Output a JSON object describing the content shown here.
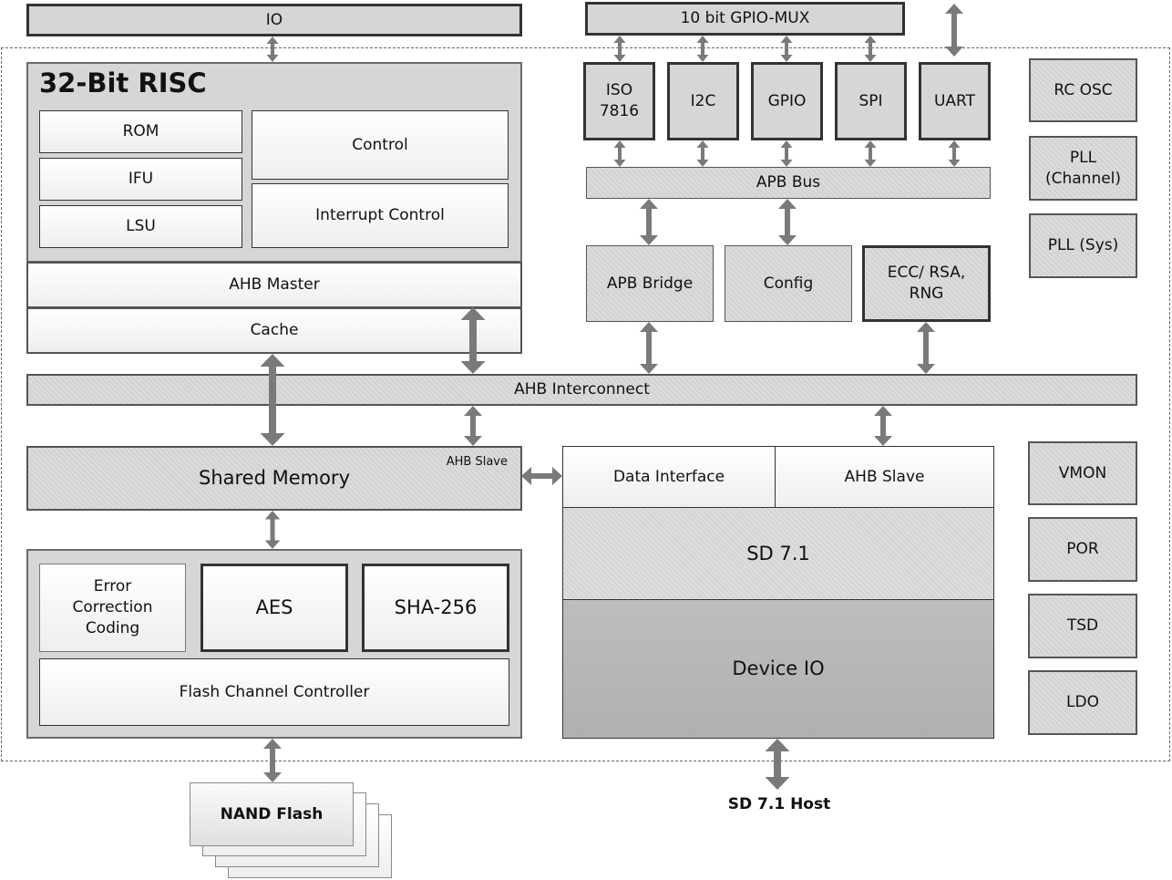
{
  "io": "IO",
  "gpio_mux": "10 bit GPIO-MUX",
  "risc": {
    "title": "32-Bit RISC",
    "rom": "ROM",
    "ifu": "IFU",
    "lsu": "LSU",
    "control": "Control",
    "interrupt": "Interrupt Control",
    "ahb_master": "AHB Master",
    "cache": "Cache"
  },
  "peripherals": [
    "ISO 7816",
    "I2C",
    "GPIO",
    "SPI",
    "UART"
  ],
  "apb_bus": "APB Bus",
  "apb_bridge": "APB Bridge",
  "config": "Config",
  "ecc_rsa": "ECC/ RSA, RNG",
  "clocks": [
    "RC OSC",
    "PLL (Channel)",
    "PLL (Sys)"
  ],
  "ahb_interconnect": "AHB Interconnect",
  "shared_memory": "Shared Memory",
  "shared_memory_slave": "AHB Slave",
  "sd": {
    "data_interface": "Data Interface",
    "ahb_slave": "AHB Slave",
    "sd71": "SD 7.1",
    "device_io": "Device IO",
    "host": "SD 7.1 Host"
  },
  "analog": [
    "VMON",
    "POR",
    "TSD",
    "LDO"
  ],
  "flash": {
    "ecc": "Error Correction Coding",
    "aes": "AES",
    "sha": "SHA-256",
    "fcc": "Flash Channel Controller",
    "nand": "NAND Flash"
  }
}
